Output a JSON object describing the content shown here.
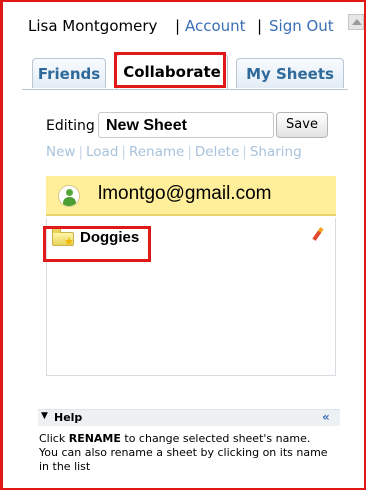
{
  "header": {
    "user_name": "Lisa Montgomery",
    "separator": "|",
    "account_link": "Account",
    "signout_link": "Sign Out"
  },
  "tabs": [
    {
      "label": "Friends",
      "active": false
    },
    {
      "label": "Collaborate",
      "active": true
    },
    {
      "label": "My Sheets",
      "active": false
    }
  ],
  "editor": {
    "editing_label": "Editing",
    "sheet_name": "New Sheet",
    "save_label": "Save"
  },
  "actions": {
    "new": "New",
    "load": "Load",
    "rename": "Rename",
    "delete": "Delete",
    "sharing": "Sharing",
    "separator": "|",
    "disabled_color": "#a8c2dc"
  },
  "collaborator": {
    "email": "lmontgo@gmail.com",
    "card_color": "#ffef9a",
    "icon": "user-icon"
  },
  "sheet_list": {
    "items": [
      {
        "label": "Doggies",
        "icon": "folder-star-icon",
        "edit_icon": "pencil-icon"
      }
    ]
  },
  "help": {
    "title": "Help",
    "collapse": "«",
    "line1_pre": "Click ",
    "line1_bold": "RENAME",
    "line1_post": " to change selected sheet's name.",
    "line2": "You can also rename a sheet by clicking on its name in the list"
  },
  "colors": {
    "highlight_box": "#e01818",
    "link": "#3a6fb5"
  }
}
